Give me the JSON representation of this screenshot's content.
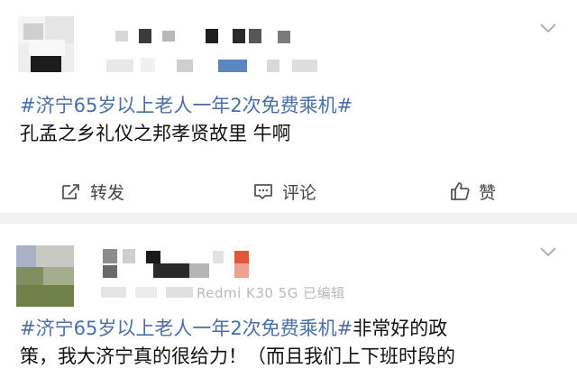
{
  "posts": [
    {
      "hashtag": "#济宁65岁以上老人一年2次免费乘机#",
      "text": "孔孟之乡礼仪之邦孝贤故里 牛啊",
      "actions": {
        "repost_label": "转发",
        "comment_label": "评论",
        "like_label": "赞"
      }
    },
    {
      "hashtag": "#济宁65岁以上老人一年2次免费乘机#",
      "text_line1": "非常好的政",
      "text_line2": "策，我大济宁真的很给力！（而且我们上下班时段的",
      "device": "Redmi K30 5G 已编辑"
    }
  ],
  "colors": {
    "hashtag": "#4a6fa8",
    "text": "#111111",
    "action_text": "#444444",
    "separator": "#f2f2f2"
  },
  "icons": {
    "more": "chevron-down-icon",
    "repost": "repost-icon",
    "comment": "comment-icon",
    "like": "thumbs-up-icon"
  }
}
